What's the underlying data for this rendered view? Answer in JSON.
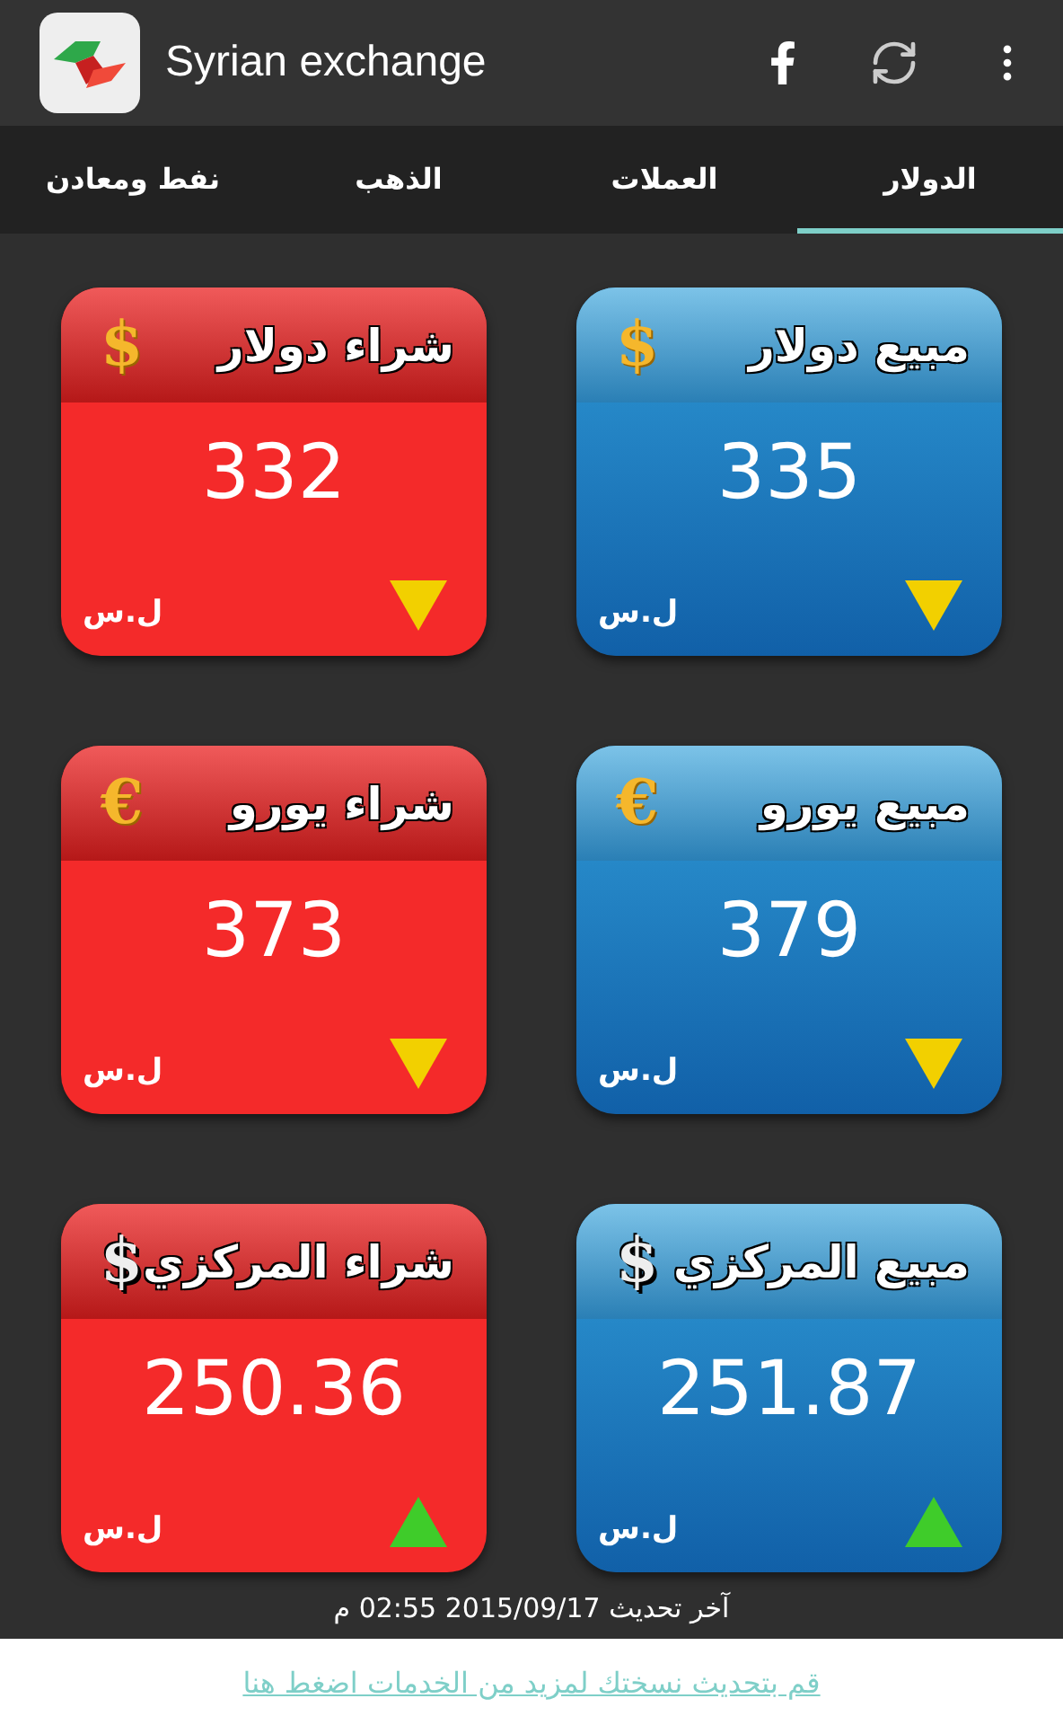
{
  "app_bar": {
    "title": "Syrian exchange"
  },
  "tabs": [
    {
      "label": "الدولار",
      "selected": true
    },
    {
      "label": "العملات",
      "selected": false
    },
    {
      "label": "الذهب",
      "selected": false
    },
    {
      "label": "نفط ومعادن",
      "selected": false
    }
  ],
  "cards": [
    {
      "kind": "sell",
      "title": "مبيع دولار",
      "symbol": "$",
      "gold": true,
      "value": "335",
      "currency": "ل.س",
      "rising": false
    },
    {
      "kind": "buy",
      "title": "شراء دولار",
      "symbol": "$",
      "gold": true,
      "value": "332",
      "currency": "ل.س",
      "rising": false
    },
    {
      "kind": "sell",
      "title": "مبيع يورو",
      "symbol": "€",
      "gold": true,
      "value": "379",
      "currency": "ل.س",
      "rising": false
    },
    {
      "kind": "buy",
      "title": "شراء يورو",
      "symbol": "€",
      "gold": true,
      "value": "373",
      "currency": "ل.س",
      "rising": false
    },
    {
      "kind": "sell",
      "title": "مبيع المركزي",
      "symbol": "$",
      "gold": false,
      "value": "251.87",
      "currency": "ل.س",
      "rising": true
    },
    {
      "kind": "buy",
      "title": "شراء المركزي",
      "symbol": "$",
      "gold": false,
      "value": "250.36",
      "currency": "ل.س",
      "rising": true
    }
  ],
  "last_update": "آخر تحديث 2015/09/17 02:55 م",
  "footer_link": "قم بتحديث نسختك لمزيد من الخدمات اضغط هنا"
}
